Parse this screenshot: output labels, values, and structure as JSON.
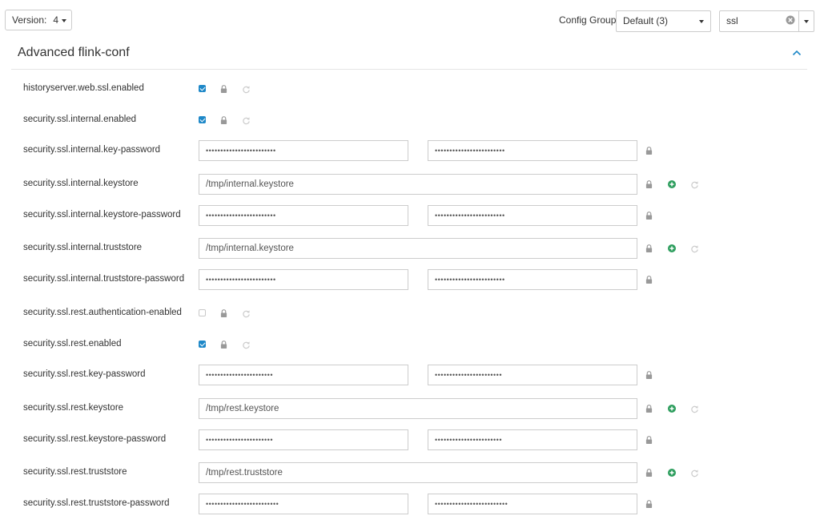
{
  "toolbar": {
    "version_label": "Version:",
    "version_value": "4",
    "config_group_label": "Config Group",
    "config_group_value": "Default (3)",
    "filter_value": "ssl"
  },
  "panel": {
    "title": "Advanced flink-conf"
  },
  "properties": [
    {
      "name": "historyserver.web.ssl.enabled",
      "type": "checkbox",
      "checked": true
    },
    {
      "name": "security.ssl.internal.enabled",
      "type": "checkbox",
      "checked": true
    },
    {
      "name": "security.ssl.internal.key-password",
      "type": "password",
      "value": "••••••••••••••••••••••••",
      "confirm": "••••••••••••••••••••••••"
    },
    {
      "name": "security.ssl.internal.keystore",
      "type": "text",
      "value": "/tmp/internal.keystore"
    },
    {
      "name": "security.ssl.internal.keystore-password",
      "type": "password",
      "value": "••••••••••••••••••••••••",
      "confirm": "••••••••••••••••••••••••"
    },
    {
      "name": "security.ssl.internal.truststore",
      "type": "text",
      "value": "/tmp/internal.keystore"
    },
    {
      "name": "security.ssl.internal.truststore-password",
      "type": "password",
      "value": "••••••••••••••••••••••••",
      "confirm": "••••••••••••••••••••••••"
    },
    {
      "name": "security.ssl.rest.authentication-enabled",
      "type": "checkbox",
      "checked": false
    },
    {
      "name": "security.ssl.rest.enabled",
      "type": "checkbox",
      "checked": true
    },
    {
      "name": "security.ssl.rest.key-password",
      "type": "password",
      "value": "•••••••••••••••••••••••",
      "confirm": "•••••••••••••••••••••••"
    },
    {
      "name": "security.ssl.rest.keystore",
      "type": "text",
      "value": "/tmp/rest.keystore"
    },
    {
      "name": "security.ssl.rest.keystore-password",
      "type": "password",
      "value": "•••••••••••••••••••••••",
      "confirm": "•••••••••••••••••••••••"
    },
    {
      "name": "security.ssl.rest.truststore",
      "type": "text",
      "value": "/tmp/rest.truststore"
    },
    {
      "name": "security.ssl.rest.truststore-password",
      "type": "password",
      "value": "•••••••••••••••••••••••••",
      "confirm": "•••••••••••••••••••••••••"
    }
  ],
  "icons": {
    "lock": "lock-icon",
    "add": "plus-circle-icon",
    "undo": "undo-icon",
    "clear": "clear-icon",
    "collapse": "chevron-up-icon"
  },
  "colors": {
    "checkbox": "#1e88c8",
    "add": "#2e9e5e",
    "lock": "#999999",
    "undo": "#cccccc"
  }
}
